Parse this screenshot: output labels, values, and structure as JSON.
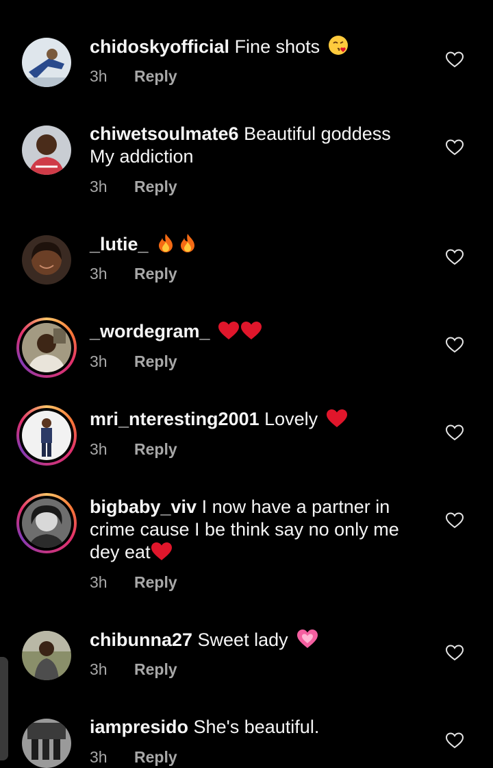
{
  "comments": [
    {
      "username": "chidoskyofficial",
      "text": " Fine shots ",
      "time": "3h",
      "reply": "Reply"
    },
    {
      "username": "chiwetsoulmate6",
      "text": " Beautiful goddess My addiction",
      "time": "3h",
      "reply": "Reply"
    },
    {
      "username": "_lutie_",
      "text": " ",
      "time": "3h",
      "reply": "Reply"
    },
    {
      "username": "_wordegram_",
      "text": " ",
      "time": "3h",
      "reply": "Reply"
    },
    {
      "username": "mri_nteresting2001",
      "text": " Lovely ",
      "time": "3h",
      "reply": "Reply"
    },
    {
      "username": "bigbaby_viv",
      "text": " I now have a partner in crime cause I be think say no only me dey eat",
      "time": "3h",
      "reply": "Reply"
    },
    {
      "username": "chibunna27",
      "text": " Sweet lady ",
      "time": "3h",
      "reply": "Reply"
    },
    {
      "username": "iampresido",
      "text": " She's beautiful.",
      "time": "3h",
      "reply": "Reply"
    }
  ],
  "icons": {
    "like": "heart-outline-icon",
    "emoji_kiss": "face-blowing-kiss",
    "emoji_fire": "fire",
    "emoji_heart": "red-heart",
    "emoji_growing_heart": "growing-heart"
  },
  "colors": {
    "background": "#000000",
    "text": "#f5f5f5",
    "secondary": "#a8a8a8",
    "heart": "#e0162b",
    "story_ring": "#e1306c"
  }
}
